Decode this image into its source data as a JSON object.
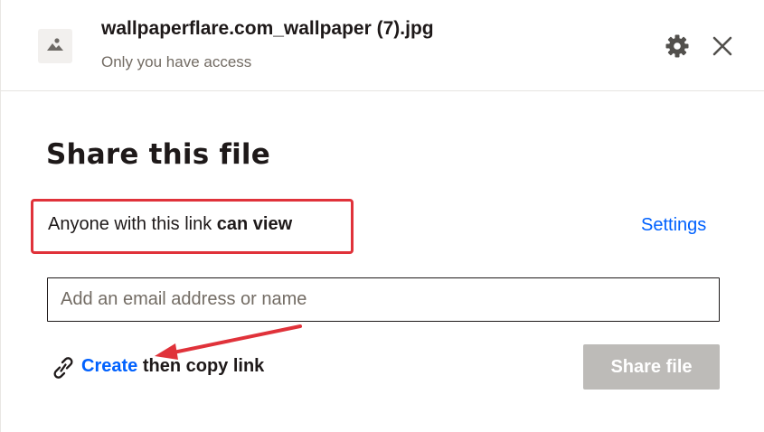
{
  "file": {
    "name": "wallpaperflare.com_wallpaper (7).jpg",
    "access": "Only you have access",
    "thumbnail_icon": "image-icon"
  },
  "header_actions": {
    "settings_icon": "gear-icon",
    "close_icon": "close-icon"
  },
  "share": {
    "title": "Share this file",
    "access_prefix": "Anyone with this link",
    "access_level": "can view",
    "settings_label": "Settings",
    "email_placeholder": "Add an email address or name",
    "email_value": "",
    "link_icon": "link-icon",
    "create_label": "Create",
    "create_suffix": "then copy link",
    "share_button_label": "Share file"
  },
  "annotations": {
    "highlight_color": "#e0323a",
    "arrow_color": "#e0323a"
  },
  "colors": {
    "accent": "#0061fe",
    "disabled_button": "#bdbbb8",
    "text": "#1e1919",
    "muted_text": "#736c64"
  }
}
